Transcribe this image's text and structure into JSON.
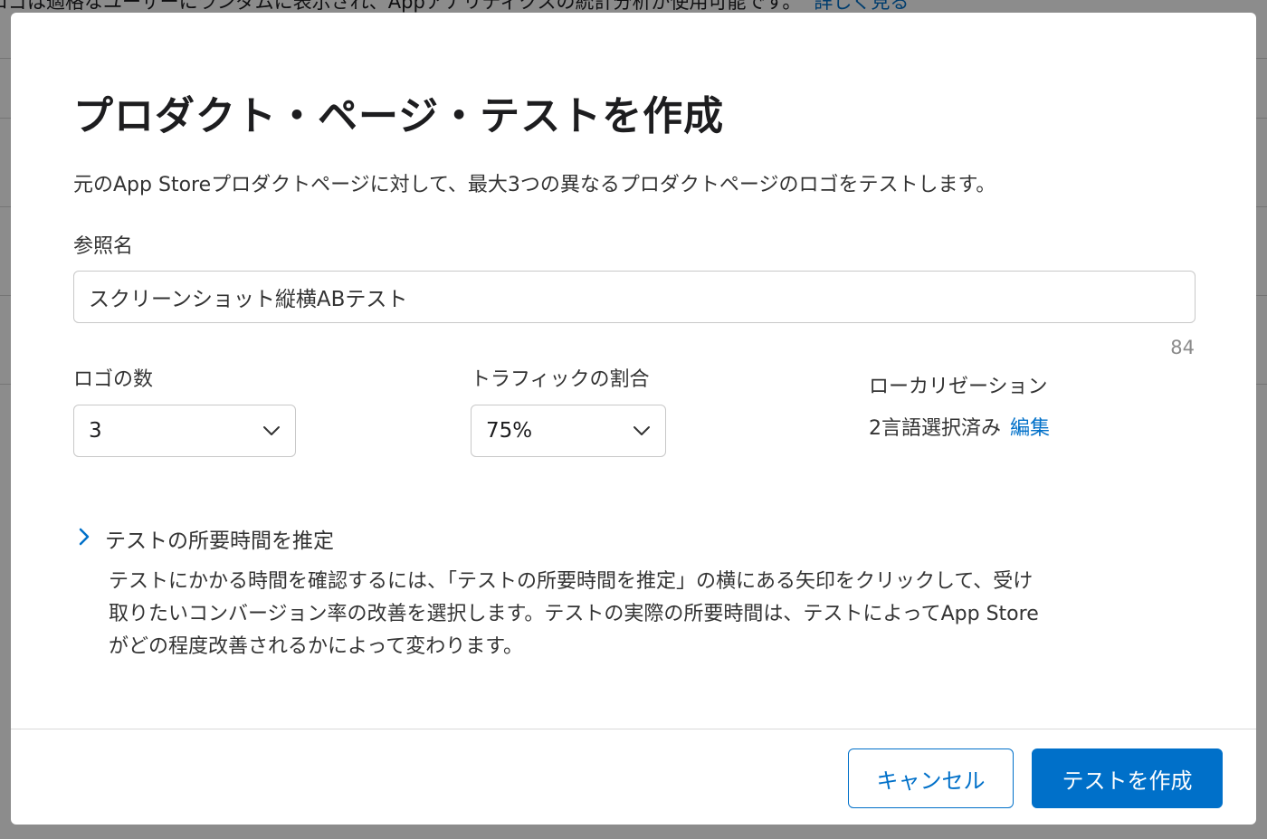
{
  "background": {
    "notice_text": "ロゴは適格なユーザーにランダムに表示され、Appアナリティクスの統計分析が使用可能です。",
    "notice_link": "詳しく見る"
  },
  "modal": {
    "title": "プロダクト・ページ・テストを作成",
    "description": "元のApp Storeプロダクトページに対して、最大3つの異なるプロダクトページのロゴをテストします。",
    "reference_name": {
      "label": "参照名",
      "value": "スクリーンショット縦横ABテスト",
      "remaining": "84"
    },
    "logo_count": {
      "label": "ロゴの数",
      "value": "3"
    },
    "traffic": {
      "label": "トラフィックの割合",
      "value": "75%"
    },
    "localization": {
      "label": "ローカリゼーション",
      "value": "2言語選択済み",
      "edit": "編集"
    },
    "estimate": {
      "label": "テストの所要時間を推定",
      "help_lines": [
        "テストにかかる時間を確認するには、「テストの所要時間を推定」の横にある矢印をクリックして、受け",
        "取りたいコンバージョン率の改善を選択します。テストの実際の所要時間は、テストによってApp Store",
        "がどの程度改善されるかによって変わります。"
      ]
    },
    "buttons": {
      "cancel": "キャンセル",
      "create": "テストを作成"
    }
  },
  "colors": {
    "accent": "#0070c9",
    "text": "#1d1d1f",
    "border": "#c8c8c8"
  }
}
